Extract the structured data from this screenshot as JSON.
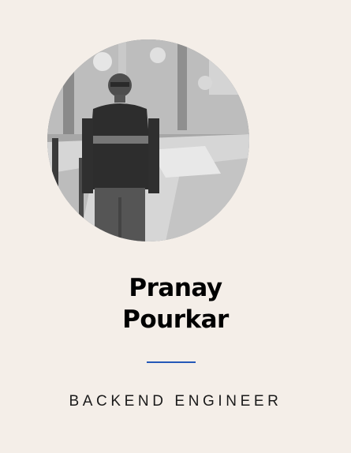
{
  "profile": {
    "first_name": "Pranay",
    "last_name": "Pourkar",
    "role": "BACKEND ENGINEER",
    "photo_icon": "profile-photo"
  },
  "colors": {
    "background": "#f4eee8",
    "name_text": "#000000",
    "divider": "#2458b8",
    "role_text": "#1a1a1a"
  }
}
